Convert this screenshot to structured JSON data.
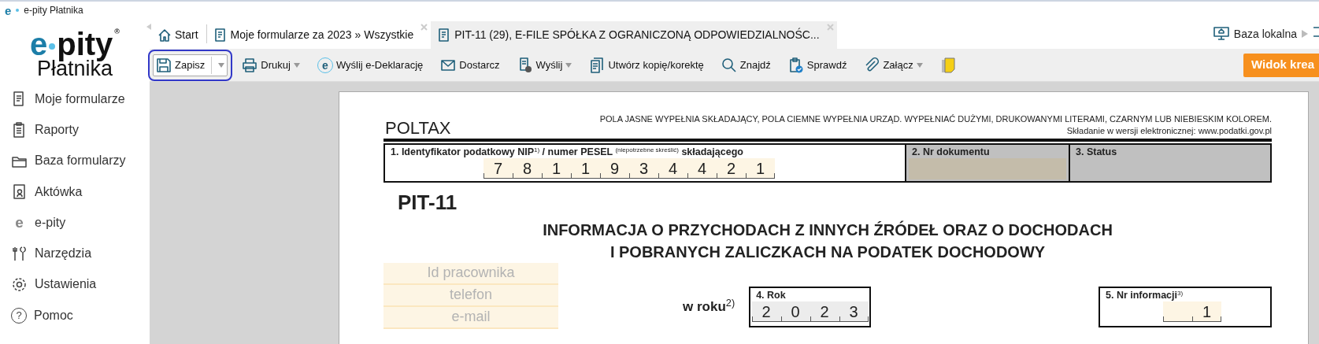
{
  "window": {
    "icon_text": "e",
    "title": "e-pity Płatnika"
  },
  "sidebar": {
    "logo": {
      "prefix": "e",
      "name": "pity",
      "registered": "®",
      "subtitle": "Płatnika"
    },
    "items": [
      {
        "label": "Moje formularze"
      },
      {
        "label": "Raporty"
      },
      {
        "label": "Baza formularzy"
      },
      {
        "label": "Aktówka"
      },
      {
        "label": "e-pity",
        "icon_text": "e"
      },
      {
        "label": "Narzędzia"
      },
      {
        "label": "Ustawienia"
      },
      {
        "label": "Pomoc",
        "icon_text": "?"
      }
    ]
  },
  "tabs": [
    {
      "label": "Start",
      "selected": false,
      "closable": false
    },
    {
      "label": "Moje formularze za 2023 » Wszystkie",
      "selected": false,
      "closable": true
    },
    {
      "label": "PIT-11 (29), E-FILE SPÓŁKA Z OGRANICZONĄ ODPOWIEDZIALNOŚC...",
      "selected": true,
      "closable": true
    }
  ],
  "connection": {
    "label": "Baza lokalna"
  },
  "toolbar": {
    "buttons": [
      {
        "label": "Zapisz",
        "dropdown": true,
        "focused": true
      },
      {
        "label": "Drukuj",
        "dropdown": true,
        "focused": false
      },
      {
        "label": "Wyślij e-Deklarację",
        "icon_text": "e",
        "dropdown": false,
        "focused": false
      },
      {
        "label": "Dostarcz",
        "dropdown": false,
        "focused": false
      },
      {
        "label": "Wyślij",
        "dropdown": true,
        "focused": false
      },
      {
        "label": "Utwórz kopię/korektę",
        "dropdown": false,
        "focused": false
      },
      {
        "label": "Znajdź",
        "dropdown": false,
        "focused": false
      },
      {
        "label": "Sprawdź",
        "dropdown": false,
        "focused": false
      },
      {
        "label": "Załącz",
        "dropdown": true,
        "focused": false
      }
    ],
    "view_button": {
      "label": "Widok krea"
    }
  },
  "form": {
    "system": "POLTAX",
    "instructions": "POLA JASNE WYPEŁNIA SKŁADAJĄCY, POLA CIEMNE WYPEŁNIA URZĄD. WYPEŁNIAĆ DUŻYMI, DRUKOWANYMI LITERAMI, CZARNYM LUB NIEBIESKIM KOLOREM.",
    "submission_note": "Składanie w wersji elektronicznej: www.podatki.gov.pl",
    "header_fields": [
      {
        "kind": "comb",
        "label": "1. Identyfikator podatkowy NIP$^{1)}$ / numer PESEL $^{(niepotrzebne skreślić)}$ składającego",
        "digits": [
          "7",
          "8",
          "1",
          "1",
          "9",
          "3",
          "4",
          "4",
          "2",
          "1"
        ]
      },
      {
        "kind": "office_input",
        "label": "2. Nr dokumentu"
      },
      {
        "kind": "office",
        "label": "3. Status"
      }
    ],
    "code": "PIT-11",
    "title_lines": [
      "INFORMACJA O PRZYCHODACH Z INNYCH ŹRÓDEŁ ORAZ O DOCHODACH",
      "I POBRANYCH ZALICZKACH NA PODATEK DOCHODOWY"
    ],
    "employee_fields": [
      {
        "placeholder": "Id pracownika"
      },
      {
        "placeholder": "telefon"
      },
      {
        "placeholder": "e-mail"
      }
    ],
    "year_prefix": "w roku$^{2)}$",
    "year": {
      "label": "4. Rok",
      "readonly": true,
      "digits": [
        "2",
        "0",
        "2",
        "3"
      ]
    },
    "info_number": {
      "label": "5. Nr informacji$^{3)}$",
      "readonly": false,
      "digits": [
        "1"
      ]
    }
  }
}
